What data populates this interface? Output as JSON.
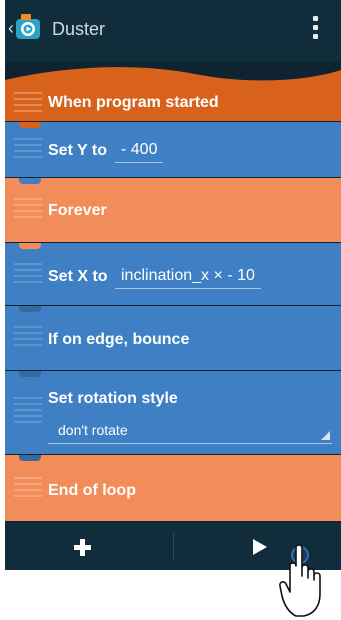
{
  "header": {
    "back_icon": "chevron-left-icon",
    "app_icon": "pocket-code-camera-icon",
    "title": "Duster",
    "menu_icon": "overflow-menu-icon"
  },
  "bricks": [
    {
      "label": "When program started",
      "color": "#d8621b"
    },
    {
      "label": "Set Y to",
      "value": "- 400",
      "color": "#3f7fc3"
    },
    {
      "label": "Forever",
      "color": "#f28c58"
    },
    {
      "label": "Set X to",
      "value": "inclination_x × - 10",
      "color": "#3f7fc3"
    },
    {
      "label": "If on edge, bounce",
      "color": "#3f7fc3"
    },
    {
      "label": "Set rotation style",
      "selected": "don't rotate",
      "color": "#3f7fc3"
    },
    {
      "label": "End of loop",
      "color": "#f28c58"
    }
  ],
  "bottom_bar": {
    "add_icon": "plus-icon",
    "play_icon": "play-icon"
  },
  "overlay": {
    "pointer_icon": "hand-pointer-icon"
  }
}
